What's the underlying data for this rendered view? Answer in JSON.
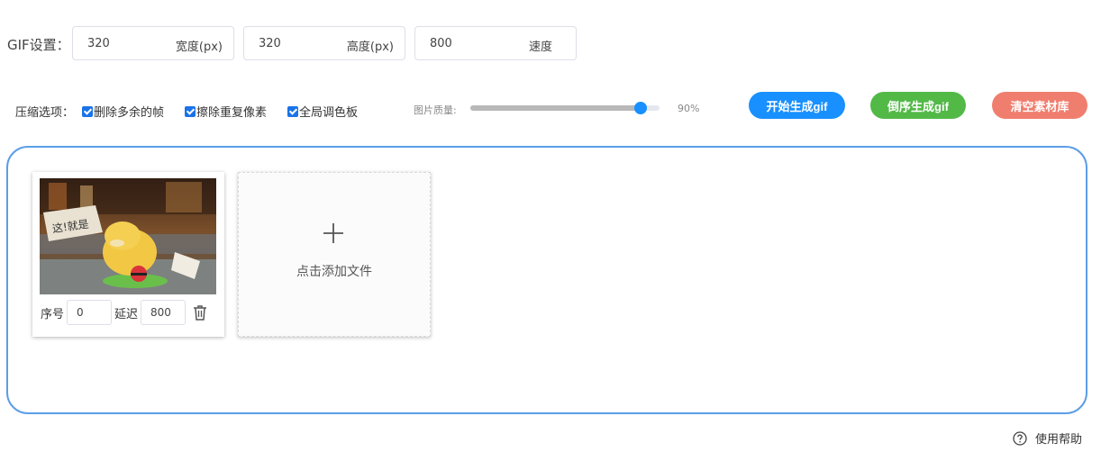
{
  "gif_settings": {
    "label": "GIF设置：",
    "width": {
      "value": "320",
      "unit": "宽度(px)"
    },
    "height": {
      "value": "320",
      "unit": "高度(px)"
    },
    "speed": {
      "value": "800",
      "unit": "速度"
    }
  },
  "compression": {
    "label": "压缩选项：",
    "options": [
      {
        "label": "删除多余的帧",
        "checked": true
      },
      {
        "label": "擦除重复像素",
        "checked": true
      },
      {
        "label": "全局调色板",
        "checked": true
      }
    ]
  },
  "quality": {
    "label": "图片质量:",
    "value_text": "90%",
    "value": 90
  },
  "buttons": {
    "start": "开始生成gif",
    "reverse": "倒序生成gif",
    "clear": "清空素材库"
  },
  "frames": [
    {
      "order_label": "序号",
      "order": "0",
      "delay_label": "延迟",
      "delay": "800"
    }
  ],
  "add_file": {
    "label": "点击添加文件"
  },
  "help": {
    "label": "使用帮助"
  },
  "colors": {
    "accent": "#1890ff",
    "success": "#52b947",
    "danger": "#f07e6e",
    "border": "#5c9ee8"
  }
}
